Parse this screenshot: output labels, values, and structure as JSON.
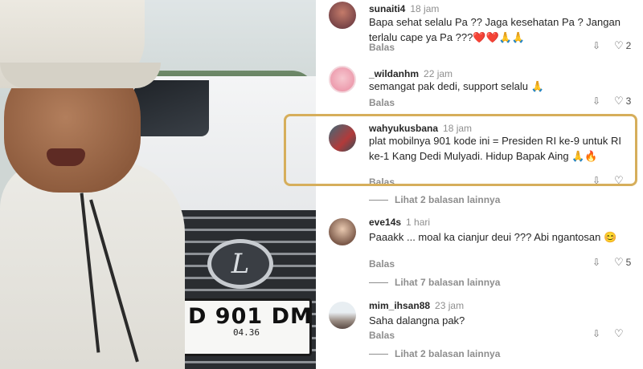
{
  "photo": {
    "plate_number": "D 901 DM",
    "plate_sub": "04.36"
  },
  "comments": [
    {
      "username": "sunaiti4",
      "time": "18 jam",
      "text": "Bapa sehat selalu Pa ?? Jaga kesehatan Pa ? Jangan terlalu cape ya Pa ???❤️❤️🙏🙏",
      "reply_label": "Balas",
      "like_count": "2"
    },
    {
      "username": "_wildanhm",
      "time": "22 jam",
      "text": "semangat pak dedi, support selalu 🙏",
      "reply_label": "Balas",
      "like_count": "3"
    },
    {
      "username": "wahyukusbana",
      "time": "18 jam",
      "text": "plat mobilnya 901 kode ini = Presiden RI ke-9 untuk RI ke-1 Kang Dedi Mulyadi. Hidup Bapak Aing 🙏🔥",
      "reply_label": "Balas",
      "like_count": "",
      "view_replies": "Lihat 2 balasan lainnya"
    },
    {
      "username": "eve14s",
      "time": "1 hari",
      "text": "Paaakk ... moal ka cianjur deui ??? Abi ngantosan 😊",
      "reply_label": "Balas",
      "like_count": "5",
      "view_replies": "Lihat 7 balasan lainnya"
    },
    {
      "username": "mim_ihsan88",
      "time": "23 jam",
      "text": "Saha dalangna pak?",
      "reply_label": "Balas",
      "like_count": "",
      "view_replies": "Lihat 2 balasan lainnya"
    }
  ],
  "icons": {
    "heart": "♡",
    "dislike": "⇩"
  },
  "colors": {
    "highlight_border": "#d6ae5b",
    "muted_text": "#8e8e8e"
  }
}
